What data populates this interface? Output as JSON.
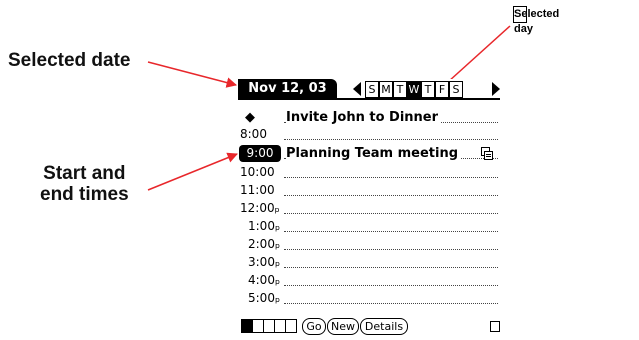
{
  "callouts": {
    "selected_date": "Selected date",
    "selected_day": "Selected day",
    "start_end_line1": "Start and",
    "start_end_line2": "end times"
  },
  "arrow_color": "#e8272b",
  "titlebar": {
    "date": "Nov 12, 03",
    "days": [
      "S",
      "M",
      "T",
      "W",
      "T",
      "F",
      "S"
    ],
    "selected_day_index": 3
  },
  "agenda": [
    {
      "time": "",
      "bullet": "◆",
      "event": "Invite John to Dinner"
    },
    {
      "time": "8:00",
      "event": ""
    },
    {
      "time": "9:00",
      "event": "Planning Team meeting",
      "selected": true,
      "note": true
    },
    {
      "time": "10:00",
      "event": ""
    },
    {
      "time": "11:00",
      "event": ""
    },
    {
      "time": "12:00ₚ",
      "event": ""
    },
    {
      "time": "1:00ₚ",
      "event": ""
    },
    {
      "time": "2:00ₚ",
      "event": ""
    },
    {
      "time": "3:00ₚ",
      "event": ""
    },
    {
      "time": "4:00ₚ",
      "event": ""
    },
    {
      "time": "5:00ₚ",
      "event": ""
    }
  ],
  "bottombar": {
    "go": "Go",
    "new": "New",
    "details": "Details"
  }
}
